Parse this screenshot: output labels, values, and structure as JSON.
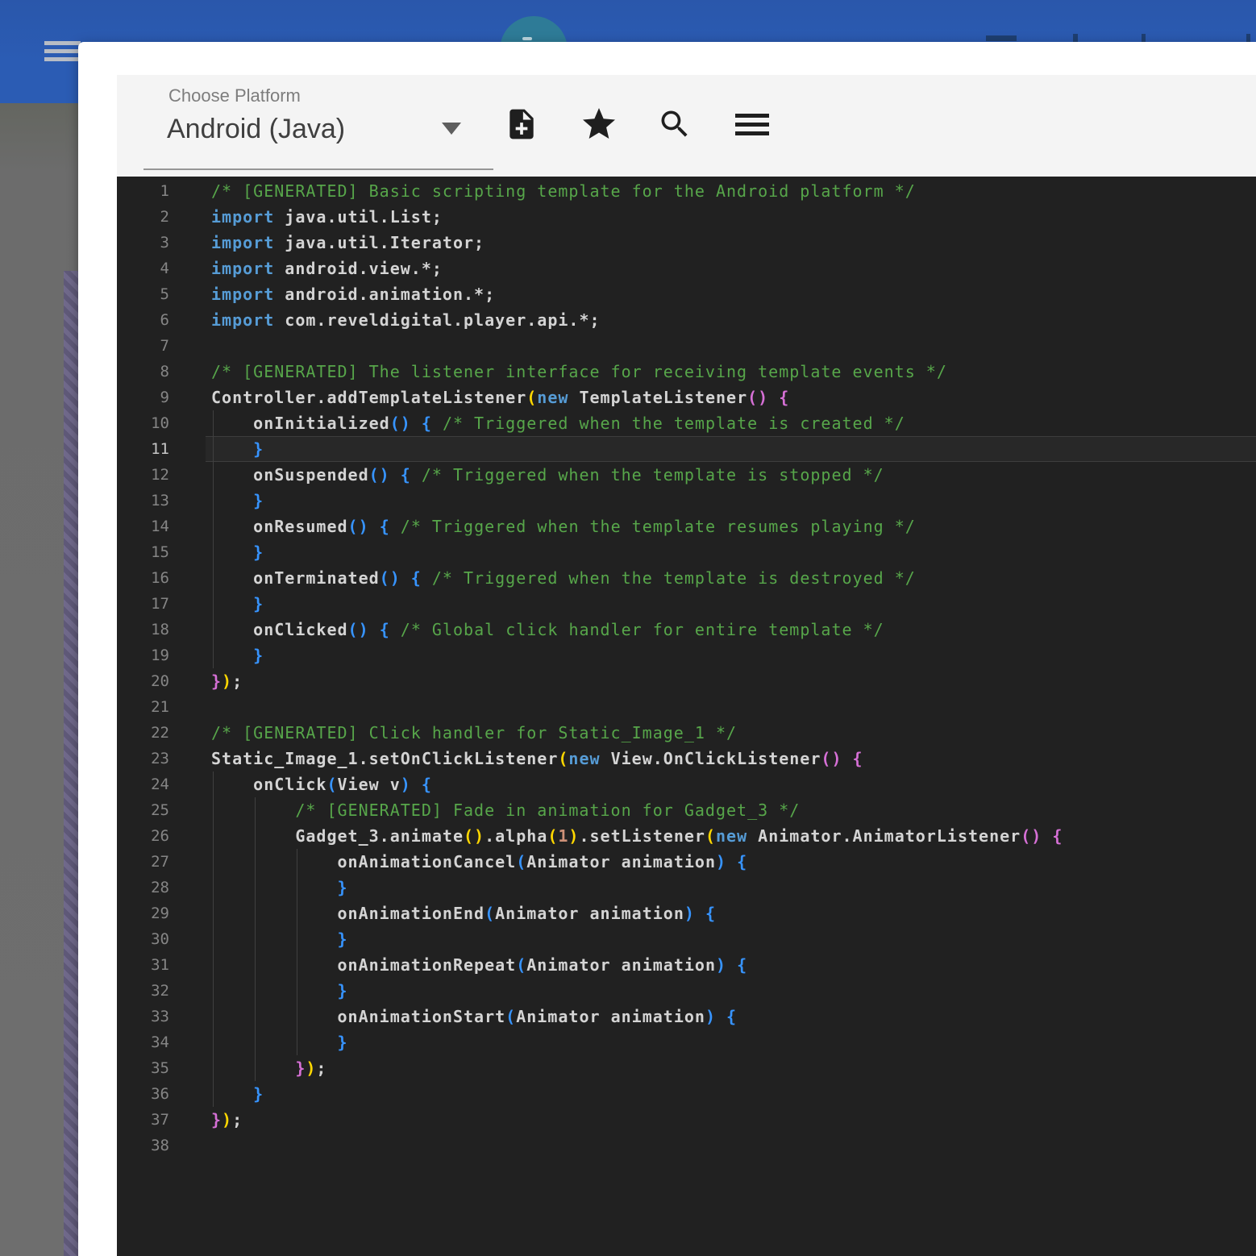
{
  "colors": {
    "header_blue": "#2b5cb4",
    "side_gray": "#6b6b6b",
    "side_purple": "#6a6386",
    "fab_teal": "#2e7b97",
    "card_bg": "#ffffff",
    "toolbar_bg": "#f4f4f4",
    "editor_bg": "#212121",
    "comment": "#57a64a",
    "keyword": "#569cd6",
    "plain": "#d4d4d4",
    "bracket1": "#ffd700",
    "bracket2": "#d670d6",
    "bracket3": "#3794ff",
    "number": "#ce9178",
    "line_number": "#858585",
    "active_line_number": "#c6c6c6"
  },
  "background": {
    "app_menu_icon": "hamburger-icon",
    "fab_icon": "circle-fab"
  },
  "toolbar": {
    "platform_label": "Choose Platform",
    "platform_value": "Android (Java)",
    "icons": [
      {
        "name": "new-file-icon"
      },
      {
        "name": "favorite-star-icon"
      },
      {
        "name": "search-icon"
      },
      {
        "name": "menu-icon"
      }
    ]
  },
  "editor": {
    "active_line": 11,
    "line_count": 38,
    "lines": [
      [
        [
          "com",
          "/* [GENERATED] Basic scripting template for the Android platform */"
        ]
      ],
      [
        [
          "kw",
          "import"
        ],
        [
          "fg",
          " java.util.List;"
        ]
      ],
      [
        [
          "kw",
          "import"
        ],
        [
          "fg",
          " java.util.Iterator;"
        ]
      ],
      [
        [
          "kw",
          "import"
        ],
        [
          "fg",
          " android.view.*;"
        ]
      ],
      [
        [
          "kw",
          "import"
        ],
        [
          "fg",
          " android.animation.*;"
        ]
      ],
      [
        [
          "kw",
          "import"
        ],
        [
          "fg",
          " com.reveldigital.player.api.*;"
        ]
      ],
      [],
      [
        [
          "com",
          "/* [GENERATED] The listener interface for receiving template events */"
        ]
      ],
      [
        [
          "fg",
          "Controller.addTemplateListener"
        ],
        [
          "b1",
          "("
        ],
        [
          "kw",
          "new"
        ],
        [
          "fg",
          " TemplateListener"
        ],
        [
          "b2",
          "()"
        ],
        [
          "fg",
          " "
        ],
        [
          "b2",
          "{"
        ]
      ],
      [
        [
          "fg",
          "    onInitialized"
        ],
        [
          "b3",
          "()"
        ],
        [
          "fg",
          " "
        ],
        [
          "b3",
          "{"
        ],
        [
          "fg",
          " "
        ],
        [
          "com",
          "/* Triggered when the template is created */"
        ]
      ],
      [
        [
          "fg",
          "    "
        ],
        [
          "b3",
          "}"
        ]
      ],
      [
        [
          "fg",
          "    onSuspended"
        ],
        [
          "b3",
          "()"
        ],
        [
          "fg",
          " "
        ],
        [
          "b3",
          "{"
        ],
        [
          "fg",
          " "
        ],
        [
          "com",
          "/* Triggered when the template is stopped */"
        ]
      ],
      [
        [
          "fg",
          "    "
        ],
        [
          "b3",
          "}"
        ]
      ],
      [
        [
          "fg",
          "    onResumed"
        ],
        [
          "b3",
          "()"
        ],
        [
          "fg",
          " "
        ],
        [
          "b3",
          "{"
        ],
        [
          "fg",
          " "
        ],
        [
          "com",
          "/* Triggered when the template resumes playing */"
        ]
      ],
      [
        [
          "fg",
          "    "
        ],
        [
          "b3",
          "}"
        ]
      ],
      [
        [
          "fg",
          "    onTerminated"
        ],
        [
          "b3",
          "()"
        ],
        [
          "fg",
          " "
        ],
        [
          "b3",
          "{"
        ],
        [
          "fg",
          " "
        ],
        [
          "com",
          "/* Triggered when the template is destroyed */"
        ]
      ],
      [
        [
          "fg",
          "    "
        ],
        [
          "b3",
          "}"
        ]
      ],
      [
        [
          "fg",
          "    onClicked"
        ],
        [
          "b3",
          "()"
        ],
        [
          "fg",
          " "
        ],
        [
          "b3",
          "{"
        ],
        [
          "fg",
          " "
        ],
        [
          "com",
          "/* Global click handler for entire template */"
        ]
      ],
      [
        [
          "fg",
          "    "
        ],
        [
          "b3",
          "}"
        ]
      ],
      [
        [
          "b2",
          "}"
        ],
        [
          "b1",
          ")"
        ],
        [
          "fg",
          ";"
        ]
      ],
      [],
      [
        [
          "com",
          "/* [GENERATED] Click handler for Static_Image_1 */"
        ]
      ],
      [
        [
          "fg",
          "Static_Image_1.setOnClickListener"
        ],
        [
          "b1",
          "("
        ],
        [
          "kw",
          "new"
        ],
        [
          "fg",
          " View.OnClickListener"
        ],
        [
          "b2",
          "()"
        ],
        [
          "fg",
          " "
        ],
        [
          "b2",
          "{"
        ]
      ],
      [
        [
          "fg",
          "    onClick"
        ],
        [
          "b3",
          "("
        ],
        [
          "fg",
          "View v"
        ],
        [
          "b3",
          ")"
        ],
        [
          "fg",
          " "
        ],
        [
          "b3",
          "{"
        ]
      ],
      [
        [
          "fg",
          "        "
        ],
        [
          "com",
          "/* [GENERATED] Fade in animation for Gadget_3 */"
        ]
      ],
      [
        [
          "fg",
          "        Gadget_3.animate"
        ],
        [
          "b1",
          "()"
        ],
        [
          "fg",
          ".alpha"
        ],
        [
          "b1",
          "("
        ],
        [
          "num",
          "1"
        ],
        [
          "b1",
          ")"
        ],
        [
          "fg",
          ".setListener"
        ],
        [
          "b1",
          "("
        ],
        [
          "kw",
          "new"
        ],
        [
          "fg",
          " Animator.AnimatorListener"
        ],
        [
          "b2",
          "()"
        ],
        [
          "fg",
          " "
        ],
        [
          "b2",
          "{"
        ]
      ],
      [
        [
          "fg",
          "            onAnimationCancel"
        ],
        [
          "b3",
          "("
        ],
        [
          "fg",
          "Animator animation"
        ],
        [
          "b3",
          ")"
        ],
        [
          "fg",
          " "
        ],
        [
          "b3",
          "{"
        ]
      ],
      [
        [
          "fg",
          "            "
        ],
        [
          "b3",
          "}"
        ]
      ],
      [
        [
          "fg",
          "            onAnimationEnd"
        ],
        [
          "b3",
          "("
        ],
        [
          "fg",
          "Animator animation"
        ],
        [
          "b3",
          ")"
        ],
        [
          "fg",
          " "
        ],
        [
          "b3",
          "{"
        ]
      ],
      [
        [
          "fg",
          "            "
        ],
        [
          "b3",
          "}"
        ]
      ],
      [
        [
          "fg",
          "            onAnimationRepeat"
        ],
        [
          "b3",
          "("
        ],
        [
          "fg",
          "Animator animation"
        ],
        [
          "b3",
          ")"
        ],
        [
          "fg",
          " "
        ],
        [
          "b3",
          "{"
        ]
      ],
      [
        [
          "fg",
          "            "
        ],
        [
          "b3",
          "}"
        ]
      ],
      [
        [
          "fg",
          "            onAnimationStart"
        ],
        [
          "b3",
          "("
        ],
        [
          "fg",
          "Animator animation"
        ],
        [
          "b3",
          ")"
        ],
        [
          "fg",
          " "
        ],
        [
          "b3",
          "{"
        ]
      ],
      [
        [
          "fg",
          "            "
        ],
        [
          "b3",
          "}"
        ]
      ],
      [
        [
          "fg",
          "        "
        ],
        [
          "b2",
          "}"
        ],
        [
          "b1",
          ")"
        ],
        [
          "fg",
          ";"
        ]
      ],
      [
        [
          "fg",
          "    "
        ],
        [
          "b3",
          "}"
        ]
      ],
      [
        [
          "b2",
          "}"
        ],
        [
          "b1",
          ")"
        ],
        [
          "fg",
          ";"
        ]
      ],
      []
    ]
  }
}
